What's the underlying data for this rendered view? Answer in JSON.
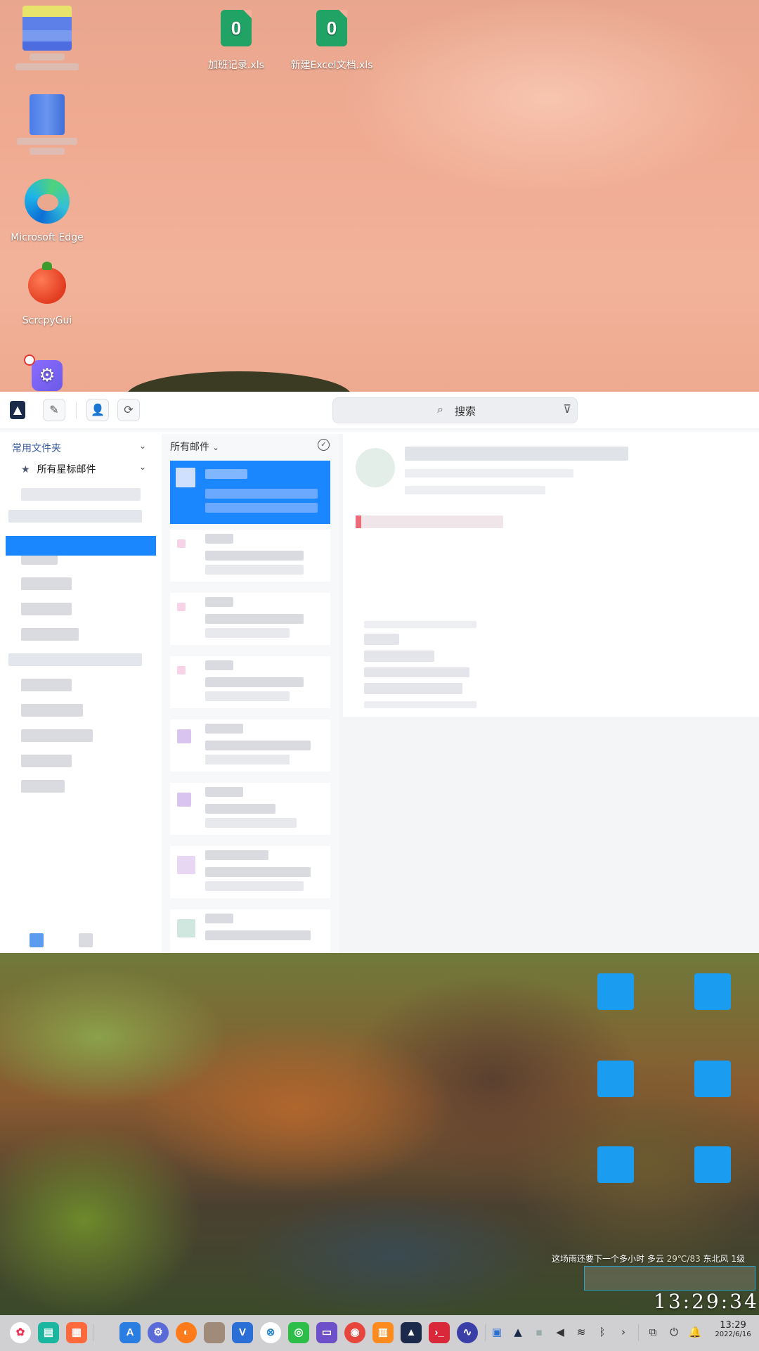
{
  "desktop": {
    "files": [
      {
        "label": "加班记录.xls",
        "icon": "excel-file-icon"
      },
      {
        "label": "新建Excel文档.xls",
        "icon": "excel-file-icon"
      }
    ],
    "apps": [
      {
        "label": "Microsoft Edge",
        "icon": "edge-icon"
      },
      {
        "label": "ScrcpyGui",
        "icon": "tomato-icon"
      }
    ],
    "weather_text": "这场雨还要下一个多小时 多云",
    "weather_temp": "29℃/83",
    "weather_wind": "东北风 1级",
    "clock": "13:29:34"
  },
  "mail": {
    "search_placeholder": "搜索",
    "sidebar": {
      "section_title": "常用文件夹",
      "starred_label": "所有星标邮件"
    },
    "list": {
      "header": "所有邮件"
    }
  },
  "taskbar": {
    "time": "13:29",
    "date": "2022/6/16"
  },
  "colors": {
    "accent": "#1a86ff",
    "excel": "#21a366",
    "selected_row": "#1a86ff"
  }
}
